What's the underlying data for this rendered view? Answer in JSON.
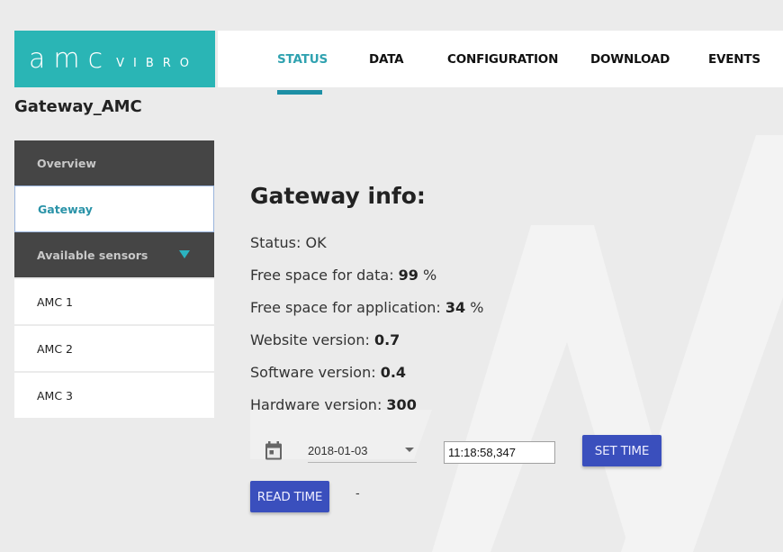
{
  "logo": {
    "main": "amc",
    "sub": "VIBRO",
    "bg_color": "#2ab5b5"
  },
  "nav": {
    "tabs": [
      {
        "label": "STATUS",
        "active": true
      },
      {
        "label": "DATA",
        "active": false
      },
      {
        "label": "CONFIGURATION",
        "active": false
      },
      {
        "label": "DOWNLOAD",
        "active": false
      },
      {
        "label": "EVENTS",
        "active": false
      }
    ],
    "active_color": "#30a2b0"
  },
  "device_title": "Gateway_AMC",
  "sidebar": {
    "overview": "Overview",
    "gateway": "Gateway",
    "available_sensors": "Available sensors",
    "sensors": [
      "AMC 1",
      "AMC 2",
      "AMC 3"
    ]
  },
  "info": {
    "heading": "Gateway info:",
    "status_label": "Status: ",
    "status_value": "OK",
    "free_data_label": "Free space for data: ",
    "free_data_value": "99",
    "free_app_label": "Free space for application: ",
    "free_app_value": "34",
    "percent": " %",
    "website_label": "Website version: ",
    "website_value": "0.7",
    "software_label": "Software version: ",
    "software_value": "0.4",
    "hardware_label": "Hardware version: ",
    "hardware_value": "300"
  },
  "time": {
    "date_value": "2018-01-03",
    "time_value": "11:18:58,347",
    "set_time_label": "SET TIME",
    "read_time_label": "READ TIME",
    "read_time_result": "-",
    "button_color": "#3a4fbd"
  }
}
